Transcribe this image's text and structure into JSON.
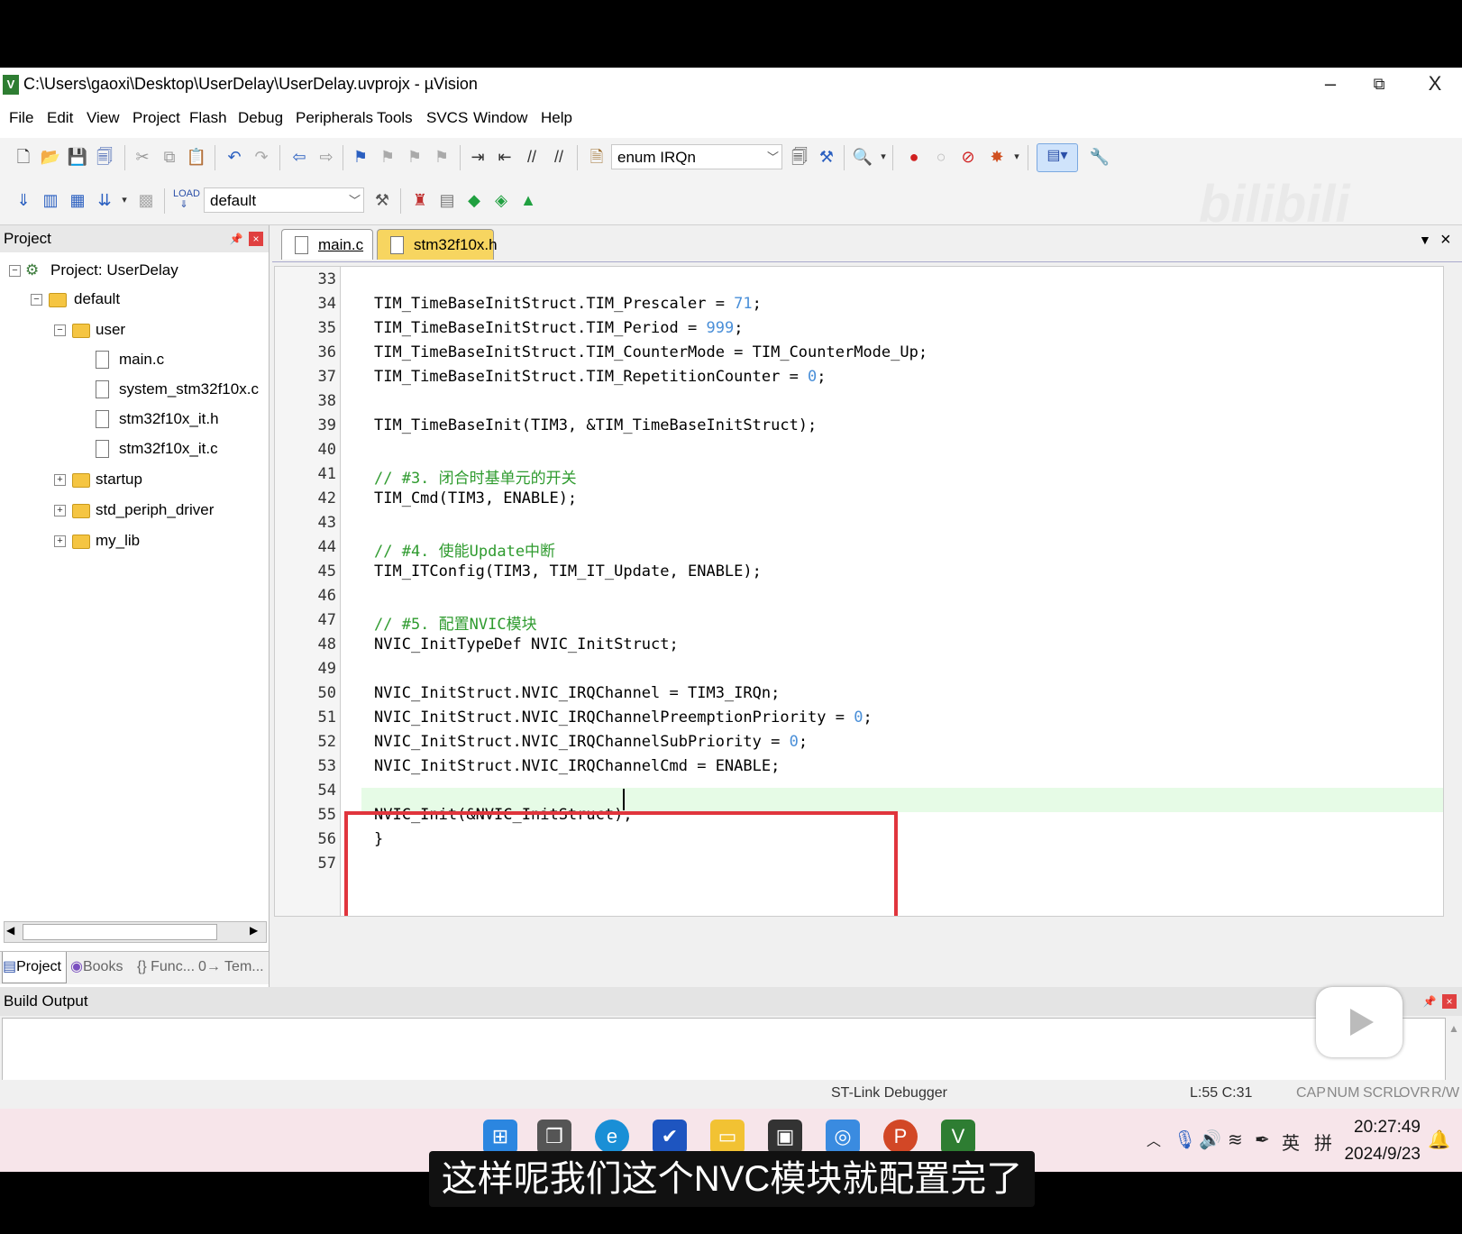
{
  "window": {
    "title": "C:\\Users\\gaoxi\\Desktop\\UserDelay\\UserDelay.uvprojx - µVision",
    "minimize": "–",
    "restore": "⧉",
    "close": "X"
  },
  "menu": [
    "File",
    "Edit",
    "View",
    "Project",
    "Flash",
    "Debug",
    "Peripherals",
    "Tools",
    "SVCS",
    "Window",
    "Help"
  ],
  "toolbar": {
    "find_combo": "enum IRQn",
    "target_combo": "default"
  },
  "project_panel": {
    "title": "Project",
    "tree": [
      {
        "label": "Project: UserDelay"
      },
      {
        "label": "default"
      },
      {
        "label": "user"
      },
      {
        "label": "main.c"
      },
      {
        "label": "system_stm32f10x.c"
      },
      {
        "label": "stm32f10x_it.h"
      },
      {
        "label": "stm32f10x_it.c"
      },
      {
        "label": "startup"
      },
      {
        "label": "std_periph_driver"
      },
      {
        "label": "my_lib"
      }
    ],
    "bottom_tabs": [
      "Project",
      "Books",
      "{} Func...",
      "0→ Tem..."
    ]
  },
  "editor": {
    "tabs": [
      "main.c",
      "stm32f10x.h"
    ],
    "line_numbers": [
      "33",
      "34",
      "35",
      "36",
      "37",
      "38",
      "39",
      "40",
      "41",
      "42",
      "43",
      "44",
      "45",
      "46",
      "47",
      "48",
      "49",
      "50",
      "51",
      "52",
      "53",
      "54",
      "55",
      "56",
      "57"
    ],
    "lines": [
      {
        "a": "",
        "n": "",
        "b": ""
      },
      {
        "a": "TIM_TimeBaseInitStruct.TIM_Prescaler = ",
        "n": "71",
        "b": ";"
      },
      {
        "a": "TIM_TimeBaseInitStruct.TIM_Period = ",
        "n": "999",
        "b": ";"
      },
      {
        "a": "TIM_TimeBaseInitStruct.TIM_CounterMode = TIM_CounterMode_Up;",
        "n": "",
        "b": ""
      },
      {
        "a": "TIM_TimeBaseInitStruct.TIM_RepetitionCounter = ",
        "n": "0",
        "b": ";"
      },
      {
        "a": "",
        "n": "",
        "b": ""
      },
      {
        "a": "TIM_TimeBaseInit(TIM3, &TIM_TimeBaseInitStruct);",
        "n": "",
        "b": ""
      },
      {
        "a": "",
        "n": "",
        "b": ""
      },
      {
        "c": "// #3. 闭合时基单元的开关"
      },
      {
        "a": "TIM_Cmd(TIM3, ENABLE);",
        "n": "",
        "b": ""
      },
      {
        "a": "",
        "n": "",
        "b": ""
      },
      {
        "c": "// #4. 使能Update中断"
      },
      {
        "a": "TIM_ITConfig(TIM3, TIM_IT_Update, ENABLE);",
        "n": "",
        "b": ""
      },
      {
        "a": "",
        "n": "",
        "b": ""
      },
      {
        "c": "// #5. 配置NVIC模块"
      },
      {
        "a": "NVIC_InitTypeDef NVIC_InitStruct;",
        "n": "",
        "b": ""
      },
      {
        "a": "",
        "n": "",
        "b": ""
      },
      {
        "a": "NVIC_InitStruct.NVIC_IRQChannel = TIM3_IRQn;",
        "n": "",
        "b": ""
      },
      {
        "a": "NVIC_InitStruct.NVIC_IRQChannelPreemptionPriority = ",
        "n": "0",
        "b": ";"
      },
      {
        "a": "NVIC_InitStruct.NVIC_IRQChannelSubPriority = ",
        "n": "0",
        "b": ";"
      },
      {
        "a": "NVIC_InitStruct.NVIC_IRQChannelCmd = ENABLE;",
        "n": "",
        "b": ""
      },
      {
        "a": "",
        "n": "",
        "b": ""
      },
      {
        "a": "NVIC_Init(&NVIC_InitStruct);",
        "n": "",
        "b": ""
      },
      {
        "a": "}",
        "n": "",
        "b": ""
      },
      {
        "a": "",
        "n": "",
        "b": ""
      }
    ]
  },
  "build_output": {
    "title": "Build Output"
  },
  "status": {
    "debugger": "ST-Link Debugger",
    "position": "L:55 C:31",
    "cap": "CAP",
    "num": "NUM",
    "scrl": "SCRL",
    "ovr": "OVR",
    "rw": "R/W"
  },
  "taskbar": {
    "tray": {
      "ime": "英",
      "ime2": "拼"
    },
    "time": "20:27:49",
    "date": "2024/9/23"
  },
  "subtitle": "这样呢我们这个NVC模块就配置完了",
  "watermark": "bilibili",
  "colors": {
    "comment": "#2f9b2f",
    "number": "#4a8fd8",
    "highlight": "#e6fbe6",
    "annotation_box": "#e0353d"
  }
}
